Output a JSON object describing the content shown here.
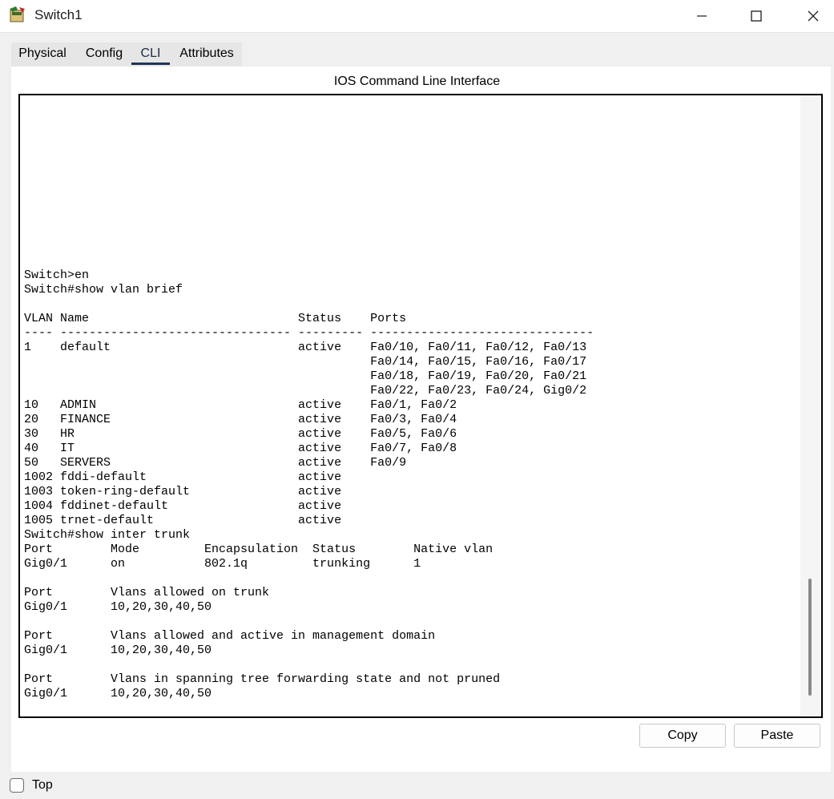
{
  "window": {
    "title": "Switch1",
    "icon": "cisco-switch-icon",
    "controls": {
      "minimize": "minimize-icon",
      "maximize": "maximize-icon",
      "close": "close-icon"
    }
  },
  "tabs": [
    {
      "label": "Physical"
    },
    {
      "label": "Config"
    },
    {
      "label": "CLI",
      "active": true
    },
    {
      "label": "Attributes"
    }
  ],
  "cli": {
    "heading": "IOS Command Line Interface",
    "output": "\n\n\n\n\n\n\n\n\n\n\n\nSwitch>en\nSwitch#show vlan brief\n\nVLAN Name                             Status    Ports\n---- -------------------------------- --------- -------------------------------\n1    default                          active    Fa0/10, Fa0/11, Fa0/12, Fa0/13\n                                                Fa0/14, Fa0/15, Fa0/16, Fa0/17\n                                                Fa0/18, Fa0/19, Fa0/20, Fa0/21\n                                                Fa0/22, Fa0/23, Fa0/24, Gig0/2\n10   ADMIN                            active    Fa0/1, Fa0/2\n20   FINANCE                          active    Fa0/3, Fa0/4\n30   HR                               active    Fa0/5, Fa0/6\n40   IT                               active    Fa0/7, Fa0/8\n50   SERVERS                          active    Fa0/9\n1002 fddi-default                     active\n1003 token-ring-default               active\n1004 fddinet-default                  active\n1005 trnet-default                    active\nSwitch#show inter trunk\nPort        Mode         Encapsulation  Status        Native vlan\nGig0/1      on           802.1q         trunking      1\n\nPort        Vlans allowed on trunk\nGig0/1      10,20,30,40,50\n\nPort        Vlans allowed and active in management domain\nGig0/1      10,20,30,40,50\n\nPort        Vlans in spanning tree forwarding state and not pruned\nGig0/1      10,20,30,40,50\n\nSwitch#"
  },
  "buttons": {
    "copy": "Copy",
    "paste": "Paste"
  },
  "footer": {
    "top_label": "Top",
    "top_checked": false
  },
  "colors": {
    "tab_underline": "#1e3554",
    "frame_bg": "#f0f0f0"
  }
}
